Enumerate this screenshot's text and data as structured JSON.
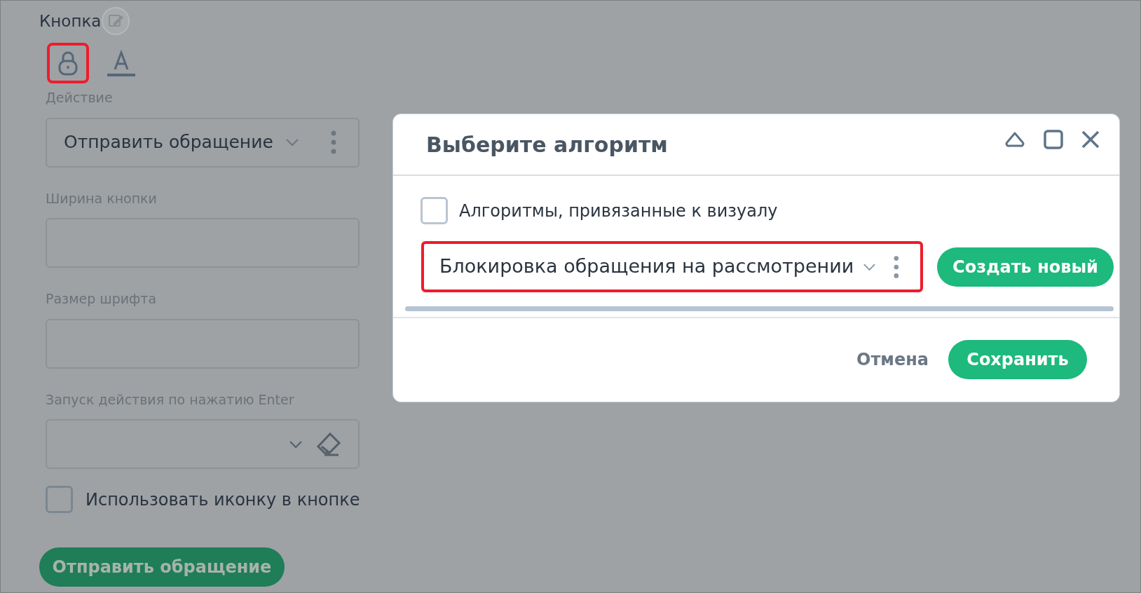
{
  "panel": {
    "title": "Кнопка",
    "toolbar": [
      {
        "kind": "lock",
        "highlighted": true
      },
      {
        "kind": "text-color",
        "highlighted": false
      }
    ],
    "fields": [
      {
        "kind": "select",
        "label": "Действие",
        "value": "Отправить обращение"
      },
      {
        "kind": "input",
        "label": "Ширина кнопки"
      },
      {
        "kind": "input",
        "label": "Размер шрифта"
      },
      {
        "kind": "clearable-select",
        "label": "Запуск действия по нажатию Enter"
      }
    ],
    "use_icon": {
      "label": "Использовать иконку в кнопке",
      "checked": false
    },
    "preview_button": "Отправить обращение"
  },
  "dialog": {
    "title": "Выберите алгоритм",
    "bound_only": {
      "label": "Алгоритмы, привязанные к визуалу",
      "checked": false
    },
    "algorithm": {
      "value": "Блокировка обращения на рассмотрении",
      "highlighted": true
    },
    "create_button": "Создать новый",
    "cancel_button": "Отмена",
    "save_button": "Сохранить"
  }
}
